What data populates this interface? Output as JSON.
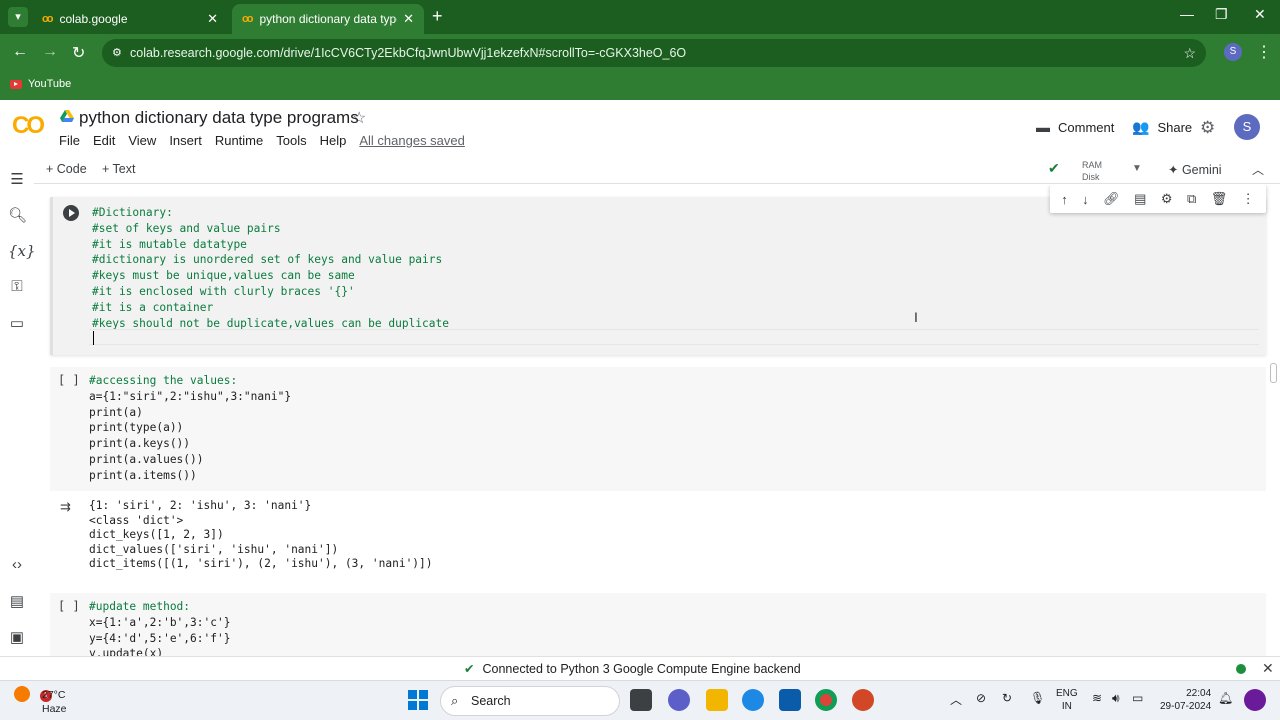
{
  "browser": {
    "tabs": [
      {
        "label": "colab.google",
        "close": "✕"
      },
      {
        "label": "python dictionary data type pro",
        "close": "✕"
      }
    ],
    "new_tab": "+",
    "url": "colab.research.google.com/drive/1IcCV6CTy2EkbCfqJwnUbwVjj1ekzefxN#scrollTo=-cGKX3heO_6O",
    "profile_initial": "S",
    "bookmark": "YouTube"
  },
  "colab": {
    "logo": "CO",
    "title": "python  dictionary data type programs",
    "menu": [
      "File",
      "Edit",
      "View",
      "Insert",
      "Runtime",
      "Tools",
      "Help"
    ],
    "saved_status": "All changes saved",
    "comment_label": "Comment",
    "share_label": "Share",
    "avatar_initial": "S",
    "add_code": "+ Code",
    "add_text": "+ Text",
    "ram_label": "RAM",
    "disk_label": "Disk",
    "gemini_label": "Gemini"
  },
  "cells": [
    {
      "type": "code",
      "lines": [
        "#Dictionary:",
        "#set of keys and value pairs",
        "#it is mutable datatype",
        "#dictionary is unordered set of keys and value pairs",
        "#keys must be unique,values can be same",
        "#it is enclosed with clurly braces '{}'",
        "#it is a container",
        "#keys should not be duplicate,values can be duplicate"
      ]
    },
    {
      "type": "code",
      "exec_count": "[ ]",
      "lines": [
        "#accessing the values:",
        "a={1:\"siri\",2:\"ishu\",3:\"nani\"}",
        "print(a)",
        "print(type(a))",
        "print(a.keys())",
        "print(a.values())",
        "print(a.items())"
      ],
      "output": [
        "{1: 'siri', 2: 'ishu', 3: 'nani'}",
        "<class 'dict'>",
        "dict_keys([1, 2, 3])",
        "dict_values(['siri', 'ishu', 'nani'])",
        "dict_items([(1, 'siri'), (2, 'ishu'), (3, 'nani')])"
      ]
    },
    {
      "type": "code",
      "exec_count": "[ ]",
      "lines": [
        "#update method:",
        "x={1:'a',2:'b',3:'c'}",
        "y={4:'d',5:'e',6:'f'}",
        "y.update(x)"
      ]
    }
  ],
  "status": {
    "message": "Connected to Python 3 Google Compute Engine backend"
  },
  "taskbar": {
    "weather_temp": "27°C",
    "weather_desc": "Haze",
    "weather_badge": "1",
    "search_label": "Search",
    "lang_1": "ENG",
    "lang_2": "IN",
    "time": "22:04",
    "date": "29-07-2024"
  }
}
